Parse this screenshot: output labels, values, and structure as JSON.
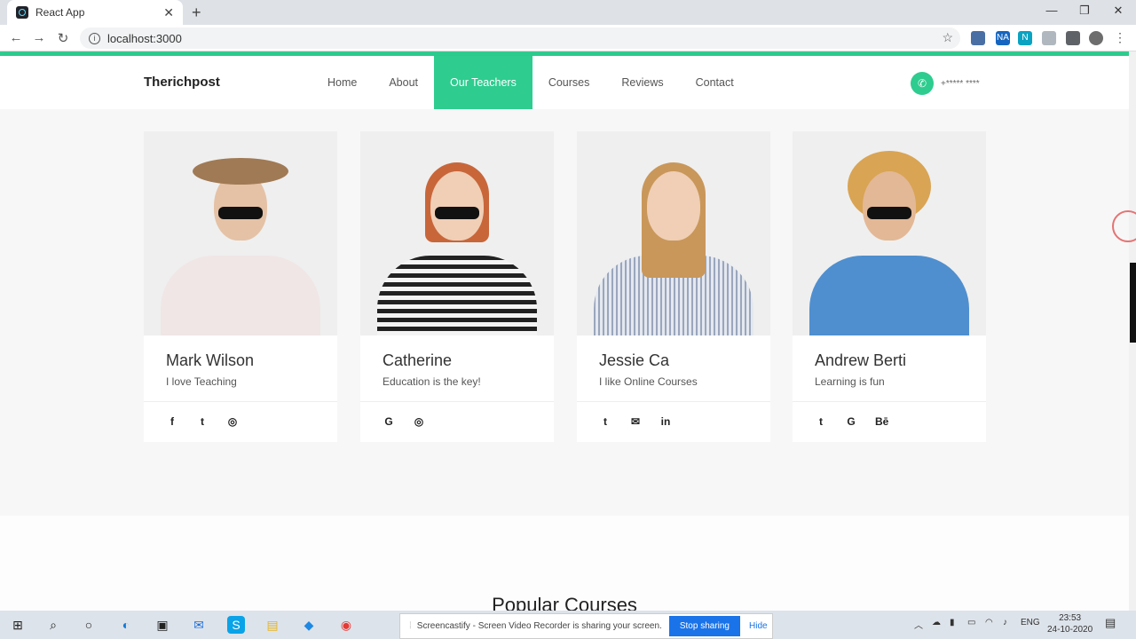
{
  "browser": {
    "tab_title": "React App",
    "tab_close": "✕",
    "new_tab": "+",
    "url": "localhost:3000",
    "window_controls": [
      "—",
      "❐",
      "✕"
    ],
    "nav_back": "←",
    "nav_forward": "→",
    "nav_reload": "↻",
    "extensions": [
      {
        "name": "ext-1",
        "label": "",
        "color": "#4a6fa5"
      },
      {
        "name": "ext-2",
        "label": "NA",
        "color": "#1565c0"
      },
      {
        "name": "ext-3",
        "label": "N",
        "color": "#0aa3c2"
      },
      {
        "name": "ext-4",
        "label": "",
        "color": "#b0b7bf"
      },
      {
        "name": "ext-5",
        "label": "",
        "color": "#5f6368"
      }
    ]
  },
  "site": {
    "brand": "Therichpost",
    "nav": [
      "Home",
      "About",
      "Our Teachers",
      "Courses",
      "Reviews",
      "Contact"
    ],
    "active_nav": "Our Teachers",
    "phone": "+***** ****",
    "accent": "#2ecc8f"
  },
  "teachers": [
    {
      "name": "Mark Wilson",
      "tagline": "I love Teaching",
      "socials": [
        "facebook",
        "twitter",
        "instagram"
      ],
      "social_glyphs": [
        "f",
        "t",
        "◎"
      ]
    },
    {
      "name": "Catherine",
      "tagline": "Education is the key!",
      "socials": [
        "google",
        "instagram"
      ],
      "social_glyphs": [
        "G",
        "◎"
      ]
    },
    {
      "name": "Jessie Ca",
      "tagline": "I like Online Courses",
      "socials": [
        "twitter",
        "email",
        "linkedin"
      ],
      "social_glyphs": [
        "t",
        "✉",
        "in"
      ]
    },
    {
      "name": "Andrew Berti",
      "tagline": "Learning is fun",
      "socials": [
        "twitter",
        "google",
        "behance"
      ],
      "social_glyphs": [
        "t",
        "G",
        "Bē"
      ]
    }
  ],
  "courses_section": {
    "title": "Popular Courses"
  },
  "taskbar": {
    "share_text": "Screencastify - Screen Video Recorder is sharing your screen.",
    "stop_label": "Stop sharing",
    "hide_label": "Hide",
    "lang": "ENG",
    "time": "23:53",
    "date": "24-10-2020"
  }
}
